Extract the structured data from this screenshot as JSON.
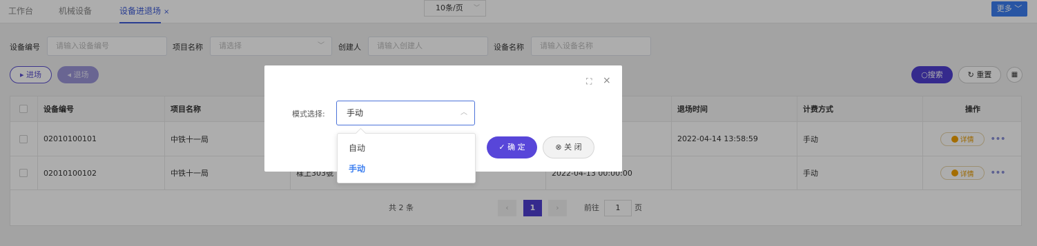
{
  "tabs": [
    {
      "label": "工作台"
    },
    {
      "label": "机械设备"
    },
    {
      "label": "设备进退场",
      "close": "×"
    }
  ],
  "more_button": "更多 ﹀",
  "filters": {
    "device_no_label": "设备编号",
    "device_no_placeholder": "请输入设备编号",
    "project_label": "项目名称",
    "project_placeholder": "请选择",
    "creator_label": "创建人",
    "creator_placeholder": "请输入创建人",
    "device_name_label": "设备名称",
    "device_name_placeholder": "请输入设备名称"
  },
  "actions": {
    "enter": "进场",
    "exit": "退场",
    "search": "搜索",
    "reset": "重置"
  },
  "table": {
    "headers": [
      "设备编号",
      "项目名称",
      "退场时间",
      "计费方式",
      "操作"
    ],
    "rows": [
      {
        "device_no": "02010100101",
        "project": "中铁十一局",
        "exit_time": "2022-04-14 13:58:59",
        "billing": "手动",
        "detail": "详情"
      },
      {
        "device_no": "02010100102",
        "project": "中铁十一局",
        "partial": "樣上303號",
        "mid_time": "2022-04-13 00:00:00",
        "exit_time": "",
        "billing": "手动",
        "detail": "详情"
      }
    ]
  },
  "pagination": {
    "total": "共 2 条",
    "page_size": "10条/页",
    "current": "1",
    "goto": "前往",
    "goto_value": "1",
    "page_unit": "页"
  },
  "modal": {
    "label": "模式选择:",
    "value": "手动",
    "ok": "确 定",
    "close": "关 闭"
  },
  "dropdown": {
    "options": [
      "自动",
      "手动"
    ]
  },
  "colors": {
    "primary": "#4f3fd0",
    "accent_blue": "#3b7ef0",
    "warning": "#f2a100"
  }
}
